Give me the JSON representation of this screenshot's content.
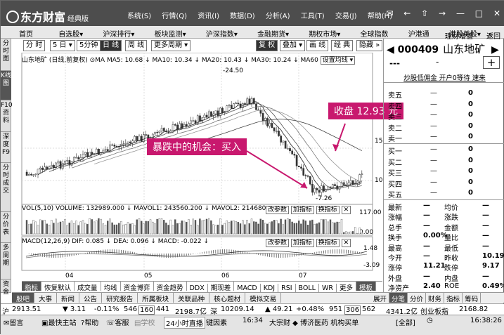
{
  "window": {
    "brand": "东方财富",
    "edition": "经典版",
    "main_menu": [
      "系统(S)",
      "行情(Q)",
      "资讯(I)",
      "数据(D)",
      "分析(A)",
      "工具(T)",
      "交易(J)",
      "帮助(H)"
    ]
  },
  "navbar": {
    "items": [
      "首页",
      "自选股▾",
      "沪深排行▾",
      "板块监测▾",
      "沪深指数▾",
      "金融期货▾",
      "期权市场▾",
      "全球指数",
      "沪港通",
      "港股美股▾",
      "»"
    ],
    "right": [
      "理财增值",
      "返回"
    ]
  },
  "left_tabs": [
    "分时图",
    "K线图",
    "F10资料",
    "深度F9",
    "分时成交",
    "分价表",
    "多周期",
    "资金"
  ],
  "toolbar": {
    "period_min": "分 时",
    "period_5d": "5 日 ▾",
    "period_5m": "5分钟",
    "period_day": "日 线",
    "period_week": "周 线",
    "more_period": "更多周期 ▾",
    "adjust": "复 权",
    "overlay": "叠加 ▾",
    "draw": "画 线",
    "classic": "经 典",
    "hide": "隐藏 »"
  },
  "chart_legend": {
    "title": "山东地矿 (日线,前复权) ⊙MA",
    "ma5": "MA5: 10.68 ↓",
    "ma10": "MA10: 10.34 ↓",
    "ma20": "MA20: 10.43 ↓",
    "ma30": "MA30: 10.24 ↓",
    "ma60": "MA60",
    "setting": "设置均线 ▾",
    "vol_label": "VOL(5,10) VOLUME: 132989.000 ↓ MAVOL1: 243560.200 ↓ MAVOL2: 214680",
    "macd_label": "MACD(12,26,9) DIF: 0.085 ↓ DEA: 0.096 ↓ MACD: -0.022 ↓",
    "param_btn": "改参数",
    "add_btn": "加指标",
    "switch_btn": "换指标"
  },
  "price_axis": [
    "15.00",
    "10.00"
  ],
  "vol_axis": [
    "117.00",
    "0.00"
  ],
  "macd_axis": [
    "1.48",
    "-3.09"
  ],
  "x_axis": [
    "04",
    "05",
    "06",
    "07"
  ],
  "annotations": {
    "high": "24.50",
    "low": "7.26",
    "close_callout": "收盘 12.93 元",
    "opportunity_callout": "暴跌中的机会：买入"
  },
  "colors": {
    "callout": "#c8186e",
    "titlebar": "#4d4d4d"
  },
  "bottom_tabs": [
    "指标",
    "恢复默认",
    "成交量",
    "均线",
    "资金博弈",
    "资金趋势",
    "DDX",
    "期现差",
    "MACD",
    "KDJ",
    "RSI",
    "BOLL",
    "WR",
    "更多",
    "模板"
  ],
  "info_tabs": [
    "股吧",
    "大事",
    "新闻",
    "公告",
    "研究报告",
    "所属板块",
    "关联品种",
    "核心题材",
    "模拟交易"
  ],
  "info_right": [
    "展开",
    "分笔",
    "分价",
    "财务",
    "指标",
    "筹码"
  ],
  "stock": {
    "code": "000409",
    "name": "山东地矿",
    "price_dash": "---",
    "dash2": "-",
    "tags": "炒股低佣金 开户0等待 速来"
  },
  "order_book": {
    "asks": [
      {
        "label": "卖五",
        "price": "—",
        "vol": "0"
      },
      {
        "label": "卖四",
        "price": "—",
        "vol": "0"
      },
      {
        "label": "卖三",
        "price": "—",
        "vol": "0"
      },
      {
        "label": "卖二",
        "price": "—",
        "vol": "0"
      },
      {
        "label": "卖一",
        "price": "—",
        "vol": "0"
      }
    ],
    "bids": [
      {
        "label": "买一",
        "price": "—",
        "vol": "0"
      },
      {
        "label": "买二",
        "price": "—",
        "vol": "0"
      },
      {
        "label": "买三",
        "price": "—",
        "vol": "0"
      },
      {
        "label": "买四",
        "price": "—",
        "vol": "0"
      },
      {
        "label": "买五",
        "price": "—",
        "vol": "0"
      }
    ]
  },
  "quote": [
    [
      "最新",
      "—",
      "均价",
      "—"
    ],
    [
      "涨幅",
      "—",
      "涨跌",
      "—"
    ],
    [
      "总手",
      "—",
      "金额",
      "—"
    ],
    [
      "换手",
      "0.00%",
      "量比",
      "—"
    ],
    [
      "最高",
      "—",
      "最低",
      "—"
    ],
    [
      "今开",
      "—",
      "昨收",
      "10.19"
    ],
    [
      "涨停",
      "11.21",
      "跌停",
      "9.17"
    ],
    [
      "外盘",
      "—",
      "内盘",
      "—"
    ],
    [
      "净资产",
      "2.40",
      "ROE",
      "0.49%"
    ]
  ],
  "index_bar": {
    "sh_label": "沪",
    "sh_val": "2913.51",
    "sh_chg": "▼ 3.11",
    "sh_pct": "-0.11%",
    "sh_up": "546",
    "sh_flat": "160",
    "sh_down": "441",
    "sh_amt": "2198.7亿",
    "sz_label": "深",
    "sz_val": "10209.14",
    "sz_chg": "▲ 49.21",
    "sz_pct": "+0.48%",
    "sz_up": "951",
    "sz_flat": "306",
    "sz_down": "562",
    "sz_amt": "4341.2亿",
    "cy_label": "创业板指",
    "cy_val": "2168.82"
  },
  "status_bar": {
    "items": [
      "留言",
      "最快主站",
      "帮助",
      "客服",
      "学校",
      "24小时直播",
      "键因素"
    ],
    "time1": "16:34",
    "news": "大宗财 ◆ 博济医药 机构买单",
    "all": "[全部]",
    "clock": "16:38:26"
  }
}
